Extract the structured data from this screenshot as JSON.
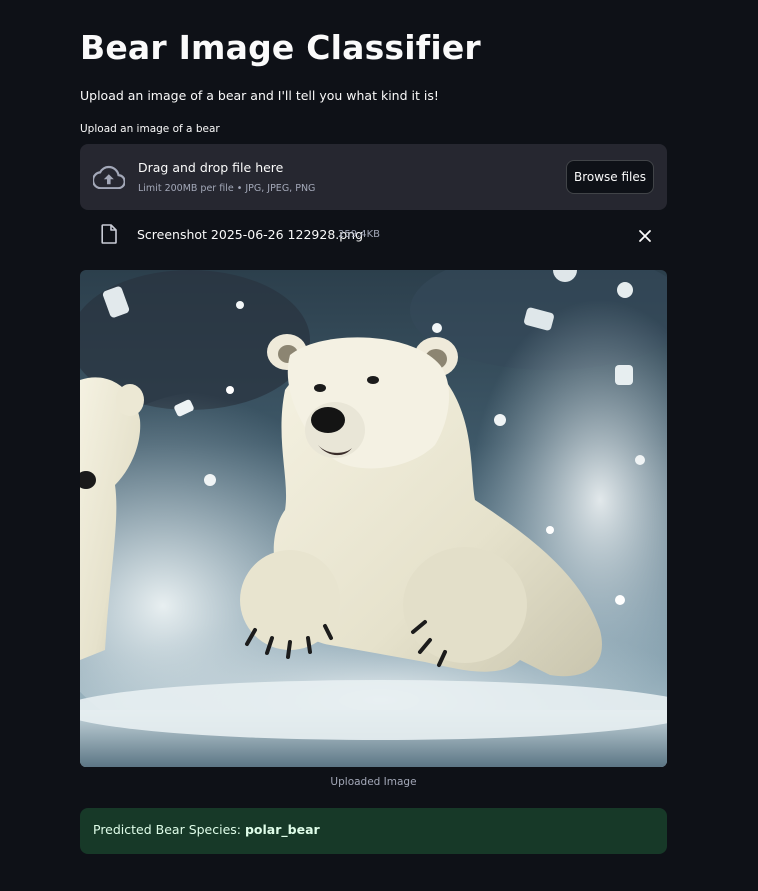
{
  "header": {
    "title": "Bear Image Classifier",
    "subtitle": "Upload an image of a bear and I'll tell you what kind it is!"
  },
  "uploader": {
    "label": "Upload an image of a bear",
    "drop_title": "Drag and drop file here",
    "limit_text": "Limit 200MB per file • JPG, JPEG, PNG",
    "browse_label": "Browse files",
    "icon": "cloud-upload-icon"
  },
  "uploaded_file": {
    "name": "Screenshot 2025-06-26 122928.png",
    "size": "259.4KB",
    "icon": "file-icon",
    "remove_icon": "close-icon"
  },
  "image": {
    "caption": "Uploaded Image"
  },
  "result": {
    "label": "Predicted Bear Species: ",
    "value": "polar_bear"
  },
  "colors": {
    "background": "#0e1117",
    "dropzone": "#262730",
    "success_background": "#173928",
    "success_text": "#dffde9",
    "muted_text": "#a3a8b8"
  }
}
